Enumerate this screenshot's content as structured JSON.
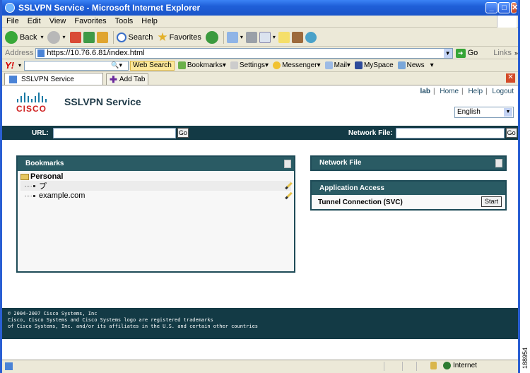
{
  "window": {
    "title": "SSLVPN Service - Microsoft Internet Explorer"
  },
  "menu": [
    "File",
    "Edit",
    "View",
    "Favorites",
    "Tools",
    "Help"
  ],
  "toolbar": {
    "back": "Back",
    "search": "Search",
    "favorites": "Favorites"
  },
  "address": {
    "label": "Address",
    "url": "https://10.76.6.81/index.html",
    "go": "Go",
    "links": "Links"
  },
  "yahoo": {
    "logo": "Y!",
    "search_button": "Web Search",
    "items": [
      "Bookmarks",
      "Settings",
      "Messenger",
      "Mail",
      "MySpace",
      "News"
    ]
  },
  "tabs": {
    "active": "SSLVPN Service",
    "add": "Add Tab"
  },
  "header": {
    "title": "SSLVPN Service",
    "logo_text": "CISCO",
    "user": "lab",
    "links": [
      "Home",
      "Help",
      "Logout"
    ],
    "language": "English"
  },
  "urlbar": {
    "url_label": "URL:",
    "go": "Go",
    "network_file_label": "Network File:"
  },
  "bookmarks": {
    "title": "Bookmarks",
    "folder": "Personal",
    "items": [
      "プ",
      "example.com"
    ]
  },
  "network_file": {
    "title": "Network File"
  },
  "application_access": {
    "title": "Application Access",
    "item": "Tunnel Connection (SVC)",
    "button": "Start"
  },
  "footer": {
    "lines": [
      "© 2004-2007 Cisco Systems, Inc",
      "Cisco, Cisco Systems and Cisco Systems logo are registered trademarks",
      "of Cisco Systems, Inc. and/or its affiliates in the U.S. and certain other countries"
    ]
  },
  "status": {
    "zone": "Internet"
  },
  "figure_id": "188954"
}
